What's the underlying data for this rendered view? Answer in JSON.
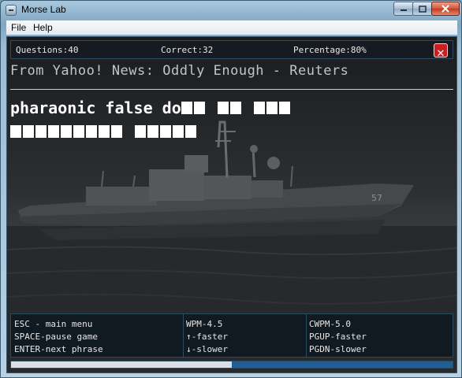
{
  "window": {
    "title": "Morse Lab"
  },
  "menu": {
    "items": [
      "File",
      "Help"
    ]
  },
  "hud": {
    "questions": "Questions:40",
    "correct": "Correct:32",
    "percentage": "Percentage:80%",
    "close_glyph": "✕"
  },
  "source": "From Yahoo! News: Oddly Enough - Reuters",
  "phrase": {
    "revealed": "pharaonic false do",
    "line1_hidden_groups": [
      2,
      2,
      3
    ],
    "line2_hidden_groups": [
      9,
      5
    ]
  },
  "footer": {
    "col1": [
      "ESC - main menu",
      "SPACE-pause game",
      "ENTER-next phrase"
    ],
    "col2": [
      "WPM-4.5",
      "↑-faster",
      "↓-slower"
    ],
    "col3": [
      "CWPM-5.0",
      "PGUP-faster",
      "PGDN-slower"
    ]
  },
  "progress": {
    "fraction": 0.5
  },
  "colors": {
    "accent_close": "#c91f1f",
    "progress_bar": "#1f5f95",
    "text": "#ffffff"
  }
}
